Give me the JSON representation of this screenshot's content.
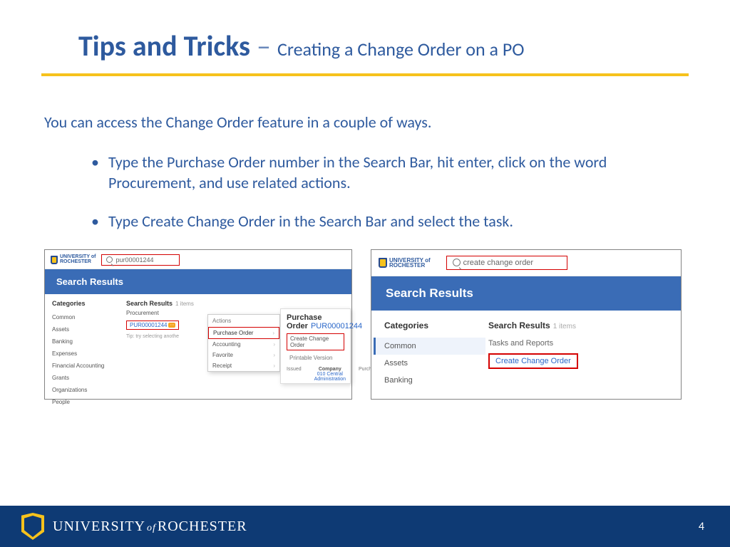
{
  "title": {
    "main": "Tips and Tricks",
    "dash": " – ",
    "sub": "Creating a Change Order on a PO"
  },
  "intro": "You can access the Change Order feature in a couple of ways.",
  "bullets": [
    "Type the Purchase Order number in the Search Bar, hit enter, click on the word Procurement, and use related actions.",
    "Type Create Change Order in the Search Bar and select the task."
  ],
  "shot_left": {
    "logo_text": "UNIVERSITY of\nROCHESTER",
    "search_value": "pur00001244",
    "blue_header": "Search Results",
    "categories_header": "Categories",
    "categories": [
      "Common",
      "Assets",
      "Banking",
      "Expenses",
      "Financial Accounting",
      "Grants",
      "Organizations",
      "People"
    ],
    "results_header": "Search Results",
    "results_count": "1 items",
    "procurement_label": "Procurement",
    "po_link": "PUR00001244",
    "tip": "Tip: try selecting anothe",
    "flyout_header": "Actions",
    "flyout_items": [
      "Purchase Order",
      "Accounting",
      "Favorite",
      "Receipt"
    ],
    "po_panel_title": "Purchase Order",
    "po_panel_num": "PUR00001244",
    "po_panel_opt1": "Create Change Order",
    "po_panel_opt2": "Printable Version",
    "meta_issued": "Issued",
    "meta_company_lbl": "Company",
    "meta_company_val": "010 Central Administration",
    "meta_purchase": "Purchase"
  },
  "shot_right": {
    "logo_text": "UNIVERSITY of\nROCHESTER",
    "search_value": "create change order",
    "blue_header": "Search Results",
    "categories_header": "Categories",
    "categories": [
      "Common",
      "Assets",
      "Banking"
    ],
    "active_index": 0,
    "results_header": "Search Results",
    "results_count": "1 items",
    "tasks_label": "Tasks and Reports",
    "cco_link": "Create Change Order"
  },
  "footer": {
    "university_1": "UNIVERSITY",
    "university_of": "of",
    "university_2": "ROCHESTER",
    "page": "4"
  }
}
